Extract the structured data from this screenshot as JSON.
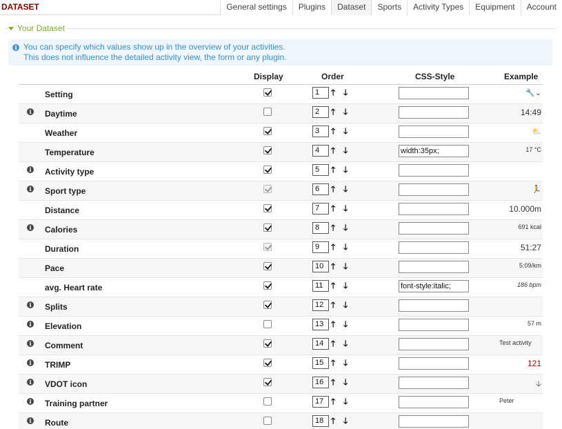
{
  "brand": "DATASET",
  "tabs": [
    "General settings",
    "Plugins",
    "Dataset",
    "Sports",
    "Activity Types",
    "Equipment",
    "Account"
  ],
  "section_title": "Your Dataset",
  "info_lines": [
    "You can specify which values show up in the overview of your activities.",
    "This does not influence the detailed activity view, the form or any plugin."
  ],
  "columns": {
    "display": "Display",
    "order": "Order",
    "css": "CSS-Style",
    "example": "Example"
  },
  "rows": [
    {
      "label": "Setting",
      "info": false,
      "display": true,
      "disabled": false,
      "order": "1",
      "css": "",
      "example": "🔧⌄",
      "ex_class": "ex-icon"
    },
    {
      "label": "Daytime",
      "info": true,
      "display": false,
      "disabled": false,
      "order": "2",
      "css": "",
      "example": "14:49",
      "ex_class": "ex-med"
    },
    {
      "label": "Weather",
      "info": false,
      "display": true,
      "disabled": false,
      "order": "3",
      "css": "",
      "example": "⛅",
      "ex_class": "ex-icon"
    },
    {
      "label": "Temperature",
      "info": false,
      "display": true,
      "disabled": false,
      "order": "4",
      "css": "width:35px;",
      "example": "17 °C",
      "ex_class": "ex-small"
    },
    {
      "label": "Activity type",
      "info": true,
      "display": true,
      "disabled": false,
      "order": "5",
      "css": "",
      "example": "",
      "ex_class": "ex-small"
    },
    {
      "label": "Sport type",
      "info": true,
      "display": true,
      "disabled": true,
      "order": "6",
      "css": "",
      "example": "🏃",
      "ex_class": "ex-icon"
    },
    {
      "label": "Distance",
      "info": false,
      "display": true,
      "disabled": false,
      "order": "7",
      "css": "",
      "example": "10.000m",
      "ex_class": "ex-med"
    },
    {
      "label": "Calories",
      "info": true,
      "display": true,
      "disabled": false,
      "order": "8",
      "css": "",
      "example": "691 kcal",
      "ex_class": "ex-small"
    },
    {
      "label": "Duration",
      "info": false,
      "display": true,
      "disabled": true,
      "order": "9",
      "css": "",
      "example": "51:27",
      "ex_class": "ex-med"
    },
    {
      "label": "Pace",
      "info": false,
      "display": true,
      "disabled": false,
      "order": "10",
      "css": "",
      "example": "5:09/km",
      "ex_class": "ex-small"
    },
    {
      "label": "avg. Heart rate",
      "info": false,
      "display": true,
      "disabled": false,
      "order": "11",
      "css": "font-style:italic;",
      "example": "186 bpm",
      "ex_class": "ex-italic"
    },
    {
      "label": "Splits",
      "info": true,
      "display": true,
      "disabled": false,
      "order": "12",
      "css": "",
      "example": "",
      "ex_class": "ex-small"
    },
    {
      "label": "Elevation",
      "info": true,
      "display": false,
      "disabled": false,
      "order": "13",
      "css": "",
      "example": "57 m",
      "ex_class": "ex-small"
    },
    {
      "label": "Comment",
      "info": true,
      "display": true,
      "disabled": false,
      "order": "14",
      "css": "",
      "example": "Test activity",
      "ex_class": "ex-left"
    },
    {
      "label": "TRIMP",
      "info": true,
      "display": true,
      "disabled": false,
      "order": "15",
      "css": "",
      "example": "121",
      "ex_class": "ex-red"
    },
    {
      "label": "VDOT icon",
      "info": true,
      "display": true,
      "disabled": false,
      "order": "16",
      "css": "",
      "example": "🡣",
      "ex_class": "ex-icon"
    },
    {
      "label": "Training partner",
      "info": true,
      "display": false,
      "disabled": false,
      "order": "17",
      "css": "",
      "example": "Peter",
      "ex_class": "ex-left"
    },
    {
      "label": "Route",
      "info": true,
      "display": false,
      "disabled": false,
      "order": "18",
      "css": "",
      "example": "",
      "ex_class": "ex-small"
    }
  ]
}
